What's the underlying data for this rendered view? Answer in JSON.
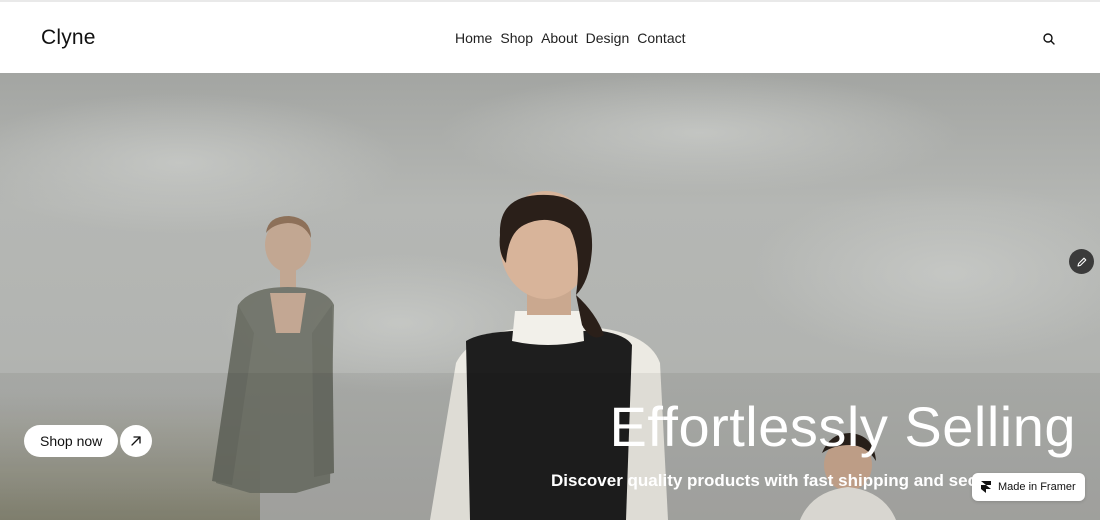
{
  "brand": {
    "name": "Clyne"
  },
  "nav": {
    "items": [
      {
        "label": "Home"
      },
      {
        "label": "Shop"
      },
      {
        "label": "About"
      },
      {
        "label": "Design"
      },
      {
        "label": "Contact"
      }
    ]
  },
  "header": {
    "search_icon": "search-icon"
  },
  "hero": {
    "title": "Effortlessly Selling",
    "subtitle": "Discover quality products with fast shipping and sec",
    "cta_label": "Shop now",
    "cta_icon": "arrow-up-right-icon",
    "edit_icon": "pencil-icon"
  },
  "badge": {
    "label": "Made in Framer",
    "icon": "framer-logo-icon"
  }
}
